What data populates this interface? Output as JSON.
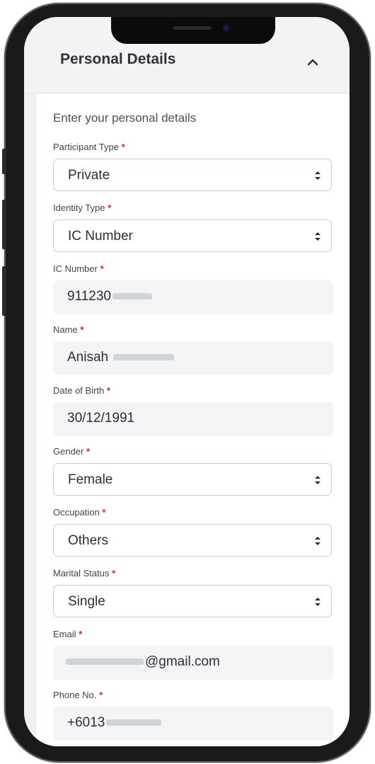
{
  "header": {
    "title": "Personal Details"
  },
  "form": {
    "intro": "Enter your personal details",
    "fields": [
      {
        "label": "Participant Type",
        "value": "Private",
        "kind": "select"
      },
      {
        "label": "Identity Type",
        "value": "IC Number",
        "kind": "select"
      },
      {
        "label": "IC Number",
        "value": "911230",
        "kind": "input"
      },
      {
        "label": "Name",
        "value": "Anisah",
        "kind": "input"
      },
      {
        "label": "Date of Birth",
        "value": "30/12/1991",
        "kind": "input"
      },
      {
        "label": "Gender",
        "value": "Female",
        "kind": "select"
      },
      {
        "label": "Occupation",
        "value": "Others",
        "kind": "select"
      },
      {
        "label": "Marital Status",
        "value": "Single",
        "kind": "select"
      },
      {
        "label": "Email",
        "value": "@gmail.com",
        "kind": "input"
      },
      {
        "label": "Phone No.",
        "value": "+6013",
        "kind": "input"
      }
    ],
    "required_marker": "*"
  },
  "colors": {
    "required": "#e02424",
    "field_border": "#c8ccd2",
    "input_bg": "#f3f4f6"
  },
  "icons": {
    "collapse": "chevron-up-icon",
    "select": "select-arrows-icon"
  }
}
